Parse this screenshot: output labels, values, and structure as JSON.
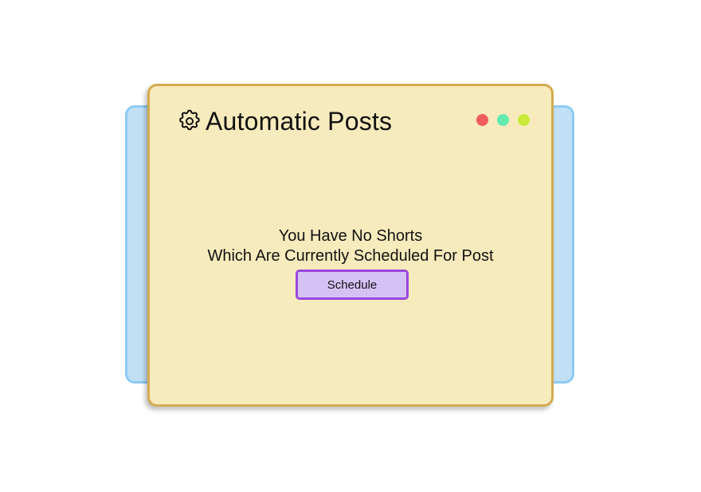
{
  "window": {
    "title": "Automatic Posts",
    "icon": "gear-icon",
    "controls": [
      {
        "name": "close",
        "color": "#ef5e5e"
      },
      {
        "name": "maximize",
        "color": "#61eab1"
      },
      {
        "name": "minimize",
        "color": "#cbeb3a"
      }
    ]
  },
  "empty_state": {
    "line1": "You Have No Shorts",
    "line2": "Which Are Currently Scheduled For Post",
    "button_label": "Schedule"
  },
  "colors": {
    "window_bg": "#f7ebbd",
    "window_border": "#d3ab4f",
    "back_card_bg": "#c1e0f5",
    "back_card_border": "#8ccbf5",
    "button_bg": "#d6c1f5",
    "button_border": "#9b46dd"
  }
}
